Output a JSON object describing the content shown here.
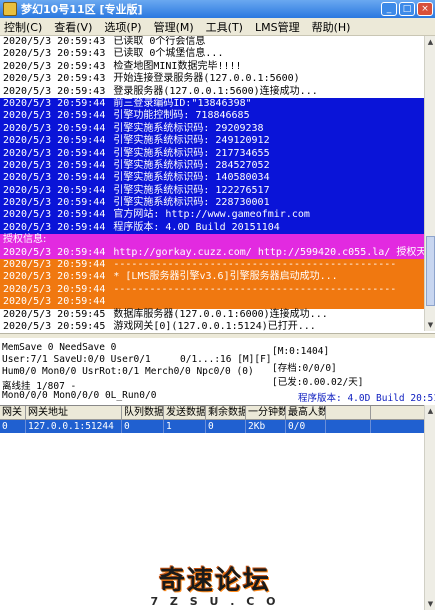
{
  "window": {
    "title": "梦幻10号11区 [专业版]",
    "minimize": "_",
    "maximize": "□",
    "close": "×"
  },
  "menu": {
    "items": [
      "控制(C)",
      "查看(V)",
      "选项(P)",
      "管理(M)",
      "工具(T)",
      "LMS管理",
      "帮助(H)"
    ]
  },
  "log": {
    "lines": [
      {
        "time": "2020/5/3 20:59:43",
        "text": "已读取 0个行会信息",
        "style": "normal"
      },
      {
        "time": "2020/5/3 20:59:43",
        "text": "已读取 0个城堡信息...",
        "style": "normal"
      },
      {
        "time": "2020/5/3 20:59:43",
        "text": "检查地图MINI数据完毕!!!!",
        "style": "normal"
      },
      {
        "time": "2020/5/3 20:59:43",
        "text": "开始连接登录服务器(127.0.0.1:5600)",
        "style": "normal"
      },
      {
        "time": "2020/5/3 20:59:43",
        "text": "登录服务器(127.0.0.1:5600)连接成功...",
        "style": "normal"
      },
      {
        "time": "2020/5/3 20:59:44",
        "text": "前三登录编码ID:\"13846398\"",
        "style": "blue"
      },
      {
        "time": "2020/5/3 20:59:44",
        "text": "引擎功能控制码: 718846685",
        "style": "blue"
      },
      {
        "time": "2020/5/3 20:59:44",
        "text": "引擎实施系统标识码: 29209238",
        "style": "blue"
      },
      {
        "time": "2020/5/3 20:59:44",
        "text": "引擎实施系统标识码: 249120912",
        "style": "blue"
      },
      {
        "time": "2020/5/3 20:59:44",
        "text": "引擎实施系统标识码: 217734655",
        "style": "blue"
      },
      {
        "time": "2020/5/3 20:59:44",
        "text": "引擎实施系统标识码: 284527052",
        "style": "blue"
      },
      {
        "time": "2020/5/3 20:59:44",
        "text": "引擎实施系统标识码: 140580034",
        "style": "blue"
      },
      {
        "time": "2020/5/3 20:59:44",
        "text": "引擎实施系统标识码: 122276517",
        "style": "blue"
      },
      {
        "time": "2020/5/3 20:59:44",
        "text": "引擎实施系统标识码: 228730001",
        "style": "blue"
      },
      {
        "time": "2020/5/3 20:59:44",
        "text": "官方网站: http://www.gameofmir.com",
        "style": "blue"
      },
      {
        "time": "2020/5/3 20:59:44",
        "text": "程序版本: 4.0D Build 20151104",
        "style": "blue"
      },
      {
        "time": "",
        "text": "授权信息:",
        "style": "magenta-head"
      },
      {
        "time": "2020/5/3 20:59:44",
        "text": "http://gorkay.cuzz.com/ http://599420.c055.la/ 授权天数 90727/95999",
        "style": "magenta"
      },
      {
        "time": "2020/5/3 20:59:44",
        "text": "-----------------------------------------------",
        "style": "orange"
      },
      {
        "time": "2020/5/3 20:59:44",
        "text": "* [LMS服务器引擎v3.6]引擎服务器启动成功...",
        "style": "orange"
      },
      {
        "time": "2020/5/3 20:59:44",
        "text": "-----------------------------------------------",
        "style": "orange"
      },
      {
        "time": "2020/5/3 20:59:44",
        "text": "",
        "style": "orange"
      },
      {
        "time": "2020/5/3 20:59:45",
        "text": "数据库服务器(127.0.0.1:6000)连接成功...",
        "style": "normal"
      },
      {
        "time": "2020/5/3 20:59:45",
        "text": "游戏网关[0](127.0.0.1:5124)已打开...",
        "style": "normal"
      }
    ]
  },
  "stats": {
    "row1_left": "MemSave 0 NeedSave 0",
    "row2_left": "User:7/1  SaveU:0/0 User0/1",
    "row2_mid": "0/1...:16 [M][F]",
    "row3_left": "Hum0/0 Mon0/0 UsrRot:0/1 Merch0/0 Npc0/0 (0)",
    "row4_left": "离线挂 1/807 -",
    "row5_left": "Mon0/0/0 Mon0/0/0 0L_Run0/0",
    "right1": "[M:0:1404]",
    "right2": "[存档:0/0/0]",
    "right3": "[已发:0.00.02/天]",
    "right4": "程序版本: 4.0D Build 20:51104"
  },
  "grid": {
    "headers": [
      "网关",
      "网关地址",
      "队列数据",
      "发送数据",
      "剩余数据",
      "一分钟数量",
      "最高人数",
      ""
    ],
    "rows": [
      [
        "0",
        "127.0.0.1:51244",
        "0",
        "1",
        "0",
        "2Kb",
        "0/0",
        ""
      ]
    ]
  },
  "watermark": {
    "main": "奇速论坛",
    "sub": "7 Z S U . C O M"
  }
}
